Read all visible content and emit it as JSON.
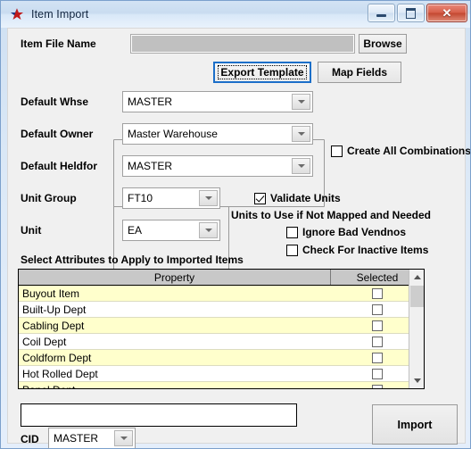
{
  "window": {
    "title": "Item Import",
    "icon": "star-icon",
    "controls": {
      "minimize": "minimize-icon",
      "maximize": "maximize-icon",
      "close": "close-icon"
    }
  },
  "form": {
    "item_file_name_label": "Item File Name",
    "item_file_name_value": "",
    "browse_button": "Browse",
    "export_template_button": "Export Template",
    "map_fields_button": "Map Fields",
    "default_whse_label": "Default Whse",
    "default_whse_value": "MASTER",
    "default_owner_label": "Default Owner",
    "default_owner_value": "Master Warehouse",
    "default_heldfor_label": "Default Heldfor",
    "default_heldfor_value": "MASTER",
    "create_all_combinations_label": "Create All Combinations",
    "create_all_combinations_checked": false,
    "unit_group_label": "Unit Group",
    "unit_group_value": "FT10",
    "unit_label": "Unit",
    "unit_value": "EA",
    "validate_units_label": "Validate Units",
    "validate_units_checked": true,
    "units_note": "Units to Use if Not Mapped and Needed",
    "ignore_bad_vendnos_label": "Ignore Bad Vendnos",
    "ignore_bad_vendnos_checked": false,
    "check_for_inactive_items_label": "Check For Inactive Items",
    "check_for_inactive_items_checked": false
  },
  "attributes": {
    "heading": "Select Attributes to Apply to Imported Items",
    "columns": [
      "Property",
      "Selected"
    ],
    "rows": [
      {
        "property": "Buyout Item",
        "selected": false
      },
      {
        "property": "Built-Up Dept",
        "selected": false
      },
      {
        "property": "Cabling Dept",
        "selected": false
      },
      {
        "property": "Coil Dept",
        "selected": false
      },
      {
        "property": "Coldform Dept",
        "selected": false
      },
      {
        "property": "Hot Rolled Dept",
        "selected": false
      },
      {
        "property": "Panel Dept",
        "selected": false
      }
    ]
  },
  "footer": {
    "status_value": "",
    "cid_label": "CID",
    "cid_value": "MASTER",
    "import_button": "Import"
  },
  "colors": {
    "row_highlight": "#ffffcc",
    "header_gray": "#c8c8c8",
    "focus_blue": "#1c6fc9",
    "close_red": "#c34730"
  }
}
